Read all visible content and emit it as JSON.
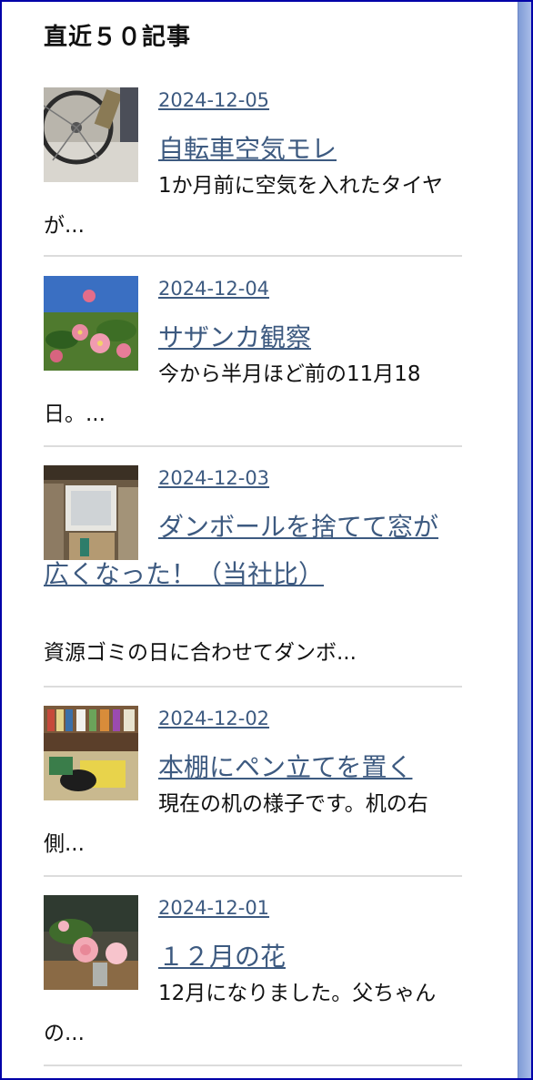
{
  "widget": {
    "heading": "直近５０記事"
  },
  "posts": [
    {
      "date": "2024-12-05",
      "title": "自転車空気モレ",
      "excerpt": "1か月前に空気を入れたタイヤが..."
    },
    {
      "date": "2024-12-04",
      "title": "サザンカ観察",
      "excerpt": "今から半月ほど前の11月18日。..."
    },
    {
      "date": "2024-12-03",
      "title": "ダンボールを捨てて窓が広くなった！（当社比）",
      "excerpt": "資源ゴミの日に合わせてダンボ..."
    },
    {
      "date": "2024-12-02",
      "title": "本棚にペン立てを置く",
      "excerpt": "現在の机の様子です。机の右側..."
    },
    {
      "date": "2024-12-01",
      "title": "１２月の花",
      "excerpt": "12月になりました。父ちゃんの..."
    }
  ],
  "colors": {
    "link": "#3d5a80",
    "frame": "#0000a8",
    "divider": "#dcdcdc"
  },
  "icons": [
    "bicycle-thumbnail",
    "sasanqua-flower-thumbnail",
    "window-room-thumbnail",
    "bookshelf-desk-thumbnail",
    "pink-flower-vase-thumbnail"
  ]
}
